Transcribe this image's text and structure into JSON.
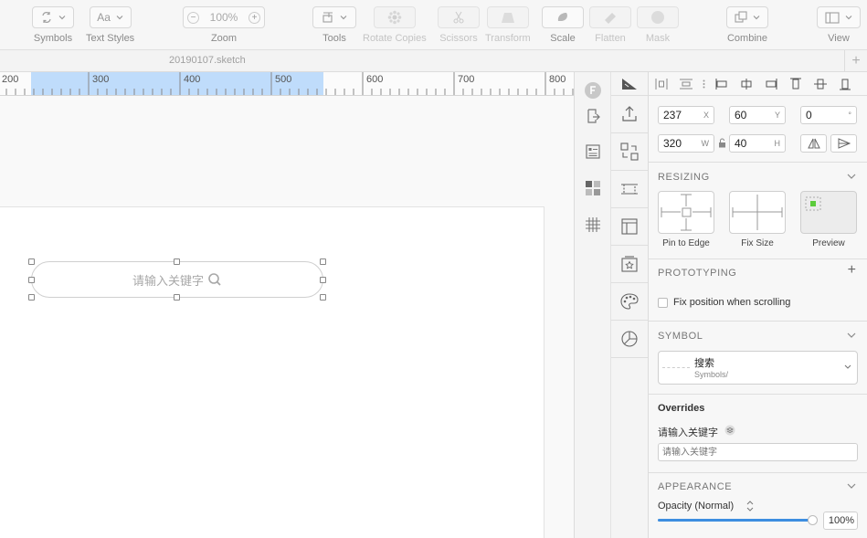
{
  "toolbar": {
    "groups": [
      {
        "label": "Symbols",
        "disabled": false,
        "icon": "symbols-icon"
      },
      {
        "label": "Text Styles",
        "disabled": false,
        "icon": "text-styles-icon",
        "button_text": "Aa"
      },
      {
        "label": "Zoom",
        "disabled": false,
        "zoom_value": "100%"
      },
      {
        "label": "Tools",
        "disabled": false,
        "icon": "tools-icon"
      },
      {
        "label": "Rotate Copies",
        "disabled": true,
        "icon": "rotate-copies-icon"
      },
      {
        "label": "Scissors",
        "disabled": true,
        "icon": "scissors-icon"
      },
      {
        "label": "Transform",
        "disabled": true,
        "icon": "transform-icon"
      },
      {
        "label": "Scale",
        "disabled": false,
        "icon": "scale-icon"
      },
      {
        "label": "Flatten",
        "disabled": true,
        "icon": "flatten-icon"
      },
      {
        "label": "Mask",
        "disabled": true,
        "icon": "mask-icon"
      },
      {
        "label": "Combine",
        "disabled": false,
        "icon": "combine-icon"
      },
      {
        "label": "View",
        "disabled": false,
        "icon": "view-icon"
      }
    ]
  },
  "document": {
    "title": "20190107.sketch",
    "add_label": "+"
  },
  "ruler": {
    "labels": [
      "200",
      "300",
      "400",
      "500",
      "600",
      "700",
      "800"
    ]
  },
  "canvas": {
    "search": {
      "placeholder": "请输入关键字"
    }
  },
  "inspector": {
    "position": {
      "x": "237",
      "x_unit": "X",
      "y": "60",
      "y_unit": "Y",
      "rotation": "0",
      "rotation_unit": "°"
    },
    "size": {
      "w": "320",
      "w_unit": "W",
      "h": "40",
      "h_unit": "H"
    },
    "resizing": {
      "title": "RESIZING",
      "options": [
        "Pin to Edge",
        "Fix Size",
        "Preview"
      ]
    },
    "prototyping": {
      "title": "PROTOTYPING",
      "checkbox_label": "Fix position when scrolling",
      "checked": false
    },
    "symbol": {
      "title": "SYMBOL",
      "name": "搜索",
      "path": "Symbols/"
    },
    "overrides": {
      "title": "Overrides",
      "label": "请输入关键字",
      "placeholder": "请输入关键字"
    },
    "appearance": {
      "title": "APPEARANCE",
      "opacity_label": "Opacity (Normal)",
      "opacity_value": "100%",
      "opacity_level": 1.0
    }
  },
  "colors": {
    "accent": "#3d8ee0",
    "ruler_selection": "#bfdcfb",
    "preview_green": "#5ccc3c"
  }
}
